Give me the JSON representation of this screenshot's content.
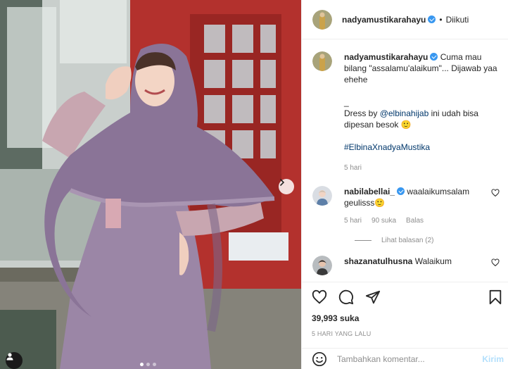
{
  "post": {
    "username": "nadyamustikarahayu",
    "follow_status": "Diikuti",
    "separator": "•"
  },
  "caption": {
    "username": "nadyamustikarahayu",
    "line1": "Cuma mau bilang \"assalamu'alaikum\"... Dijawab yaa ehehe",
    "line2": "_",
    "dress_prefix": "Dress by ",
    "mention": "@elbinahijab",
    "dress_suffix": " ini udah bisa dipesan besok 🙂",
    "hashtag": "#ElbinaXnadyaMustika",
    "time": "5 hari"
  },
  "comments": [
    {
      "username": "nabilabellai_",
      "text": "waalaikumsalam geulisss🙂",
      "time": "5 hari",
      "likes": "90 suka",
      "reply": "Balas",
      "view_replies": "Lihat balasan (2)"
    },
    {
      "username": "shazanatulhusna",
      "text": "Walaikum"
    }
  ],
  "footer": {
    "like_count": "39,993 suka",
    "time_ago": "5 HARI YANG LALU"
  },
  "add_comment": {
    "placeholder": "Tambahkan komentar...",
    "post_label": "Kirim"
  },
  "icons": {
    "like": "heart-icon",
    "comment": "comment-icon",
    "share": "share-icon",
    "save": "bookmark-icon",
    "next": "chevron-right-icon",
    "tag": "user-tag-icon",
    "emoji": "emoji-icon"
  },
  "colors": {
    "verified": "#3897f0",
    "link": "#00376b",
    "muted": "#8e8e8e",
    "post_disabled": "#b2dffc",
    "dress": "#9b86a6"
  },
  "carousel": {
    "slide": 1,
    "total": 3
  }
}
